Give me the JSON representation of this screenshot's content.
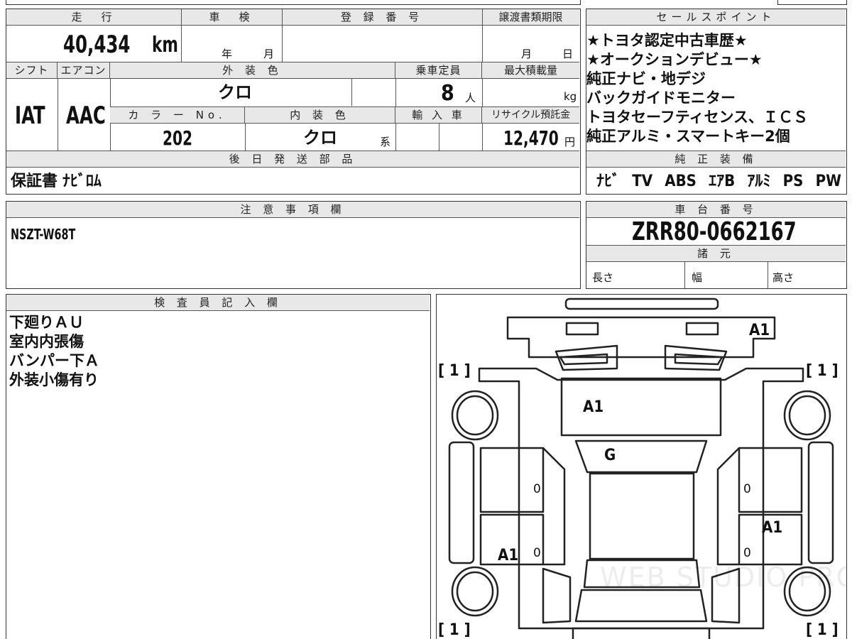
{
  "top_table": {
    "mileage_label": "走　行",
    "mileage_value": "40,434",
    "mileage_unit": "km",
    "inspection_label": "車　検",
    "inspection_year_unit": "年",
    "inspection_month_unit": "月",
    "registration_label": "登 録 番 号",
    "transfer_label": "譲渡書類期限",
    "transfer_month_unit": "月",
    "transfer_day_unit": "日",
    "shift_label": "シフト",
    "shift_value": "IAT",
    "aircon_label": "エアコン",
    "aircon_value": "AAC",
    "exterior_color_label": "外 装 色",
    "exterior_color_value": "クロ",
    "capacity_label": "乗車定員",
    "capacity_value": "8",
    "capacity_unit": "人",
    "max_load_label": "最大積載量",
    "max_load_unit": "kg",
    "color_no_label": "カ ラ ー No.",
    "color_no_value": "202",
    "interior_color_label": "内 装 色",
    "interior_color_value": "クロ",
    "interior_color_suffix": "系",
    "import_label": "輸 入 車",
    "recycle_label": "リサイクル預託金",
    "recycle_value": "12,470",
    "recycle_unit": "円",
    "later_parts_label": "後 日 発 送 部 品",
    "later_parts_value": "保証書  ﾅﾋﾞﾛﾑ"
  },
  "sales_points": {
    "label": "セールスポイント",
    "lines": [
      "★トヨタ認定中古車歴★",
      "★オークションデビュー★",
      "純正ナビ・地デジ",
      "バックガイドモニター",
      "トヨタセーフティセンス、ＩＣＳ",
      "純正アルミ・スマートキー2個"
    ]
  },
  "equipment": {
    "label": "純 正 装 備",
    "items": [
      "ﾅﾋﾞ",
      "TV",
      "ABS",
      "ｴｱB",
      "ｱﾙﾐ",
      "PS",
      "PW"
    ]
  },
  "notes": {
    "label": "注 意 事 項 欄",
    "value": "NSZT-W68T"
  },
  "chassis": {
    "label": "車 台 番 号",
    "value": "ZRR80-0662167",
    "specs_label": "諸 元",
    "length_label": "長さ",
    "width_label": "幅",
    "height_label": "高さ"
  },
  "inspector": {
    "label": "検 査 員 記 入 欄",
    "lines": [
      "下廻りＡＵ",
      "室内内張傷",
      "バンパー下Ａ",
      "外装小傷有り"
    ]
  },
  "diagram": {
    "front_bumper_mark": "A1",
    "hood_mark": "A1",
    "windshield_mark": "G",
    "left_rear_door_mark": "A1",
    "right_rear_door_mark": "A1",
    "left_front_door_zero": "0",
    "left_rear_door_zero": "0",
    "right_front_door_zero": "0",
    "right_rear_door_zero": "0",
    "tire_front_left": "[ 1 ]",
    "tire_front_right": "[ 1 ]",
    "tire_rear_left": "[ 1 ]",
    "tire_rear_right": "[ 1 ]",
    "watermark": "WEB STUDIO PRO"
  }
}
